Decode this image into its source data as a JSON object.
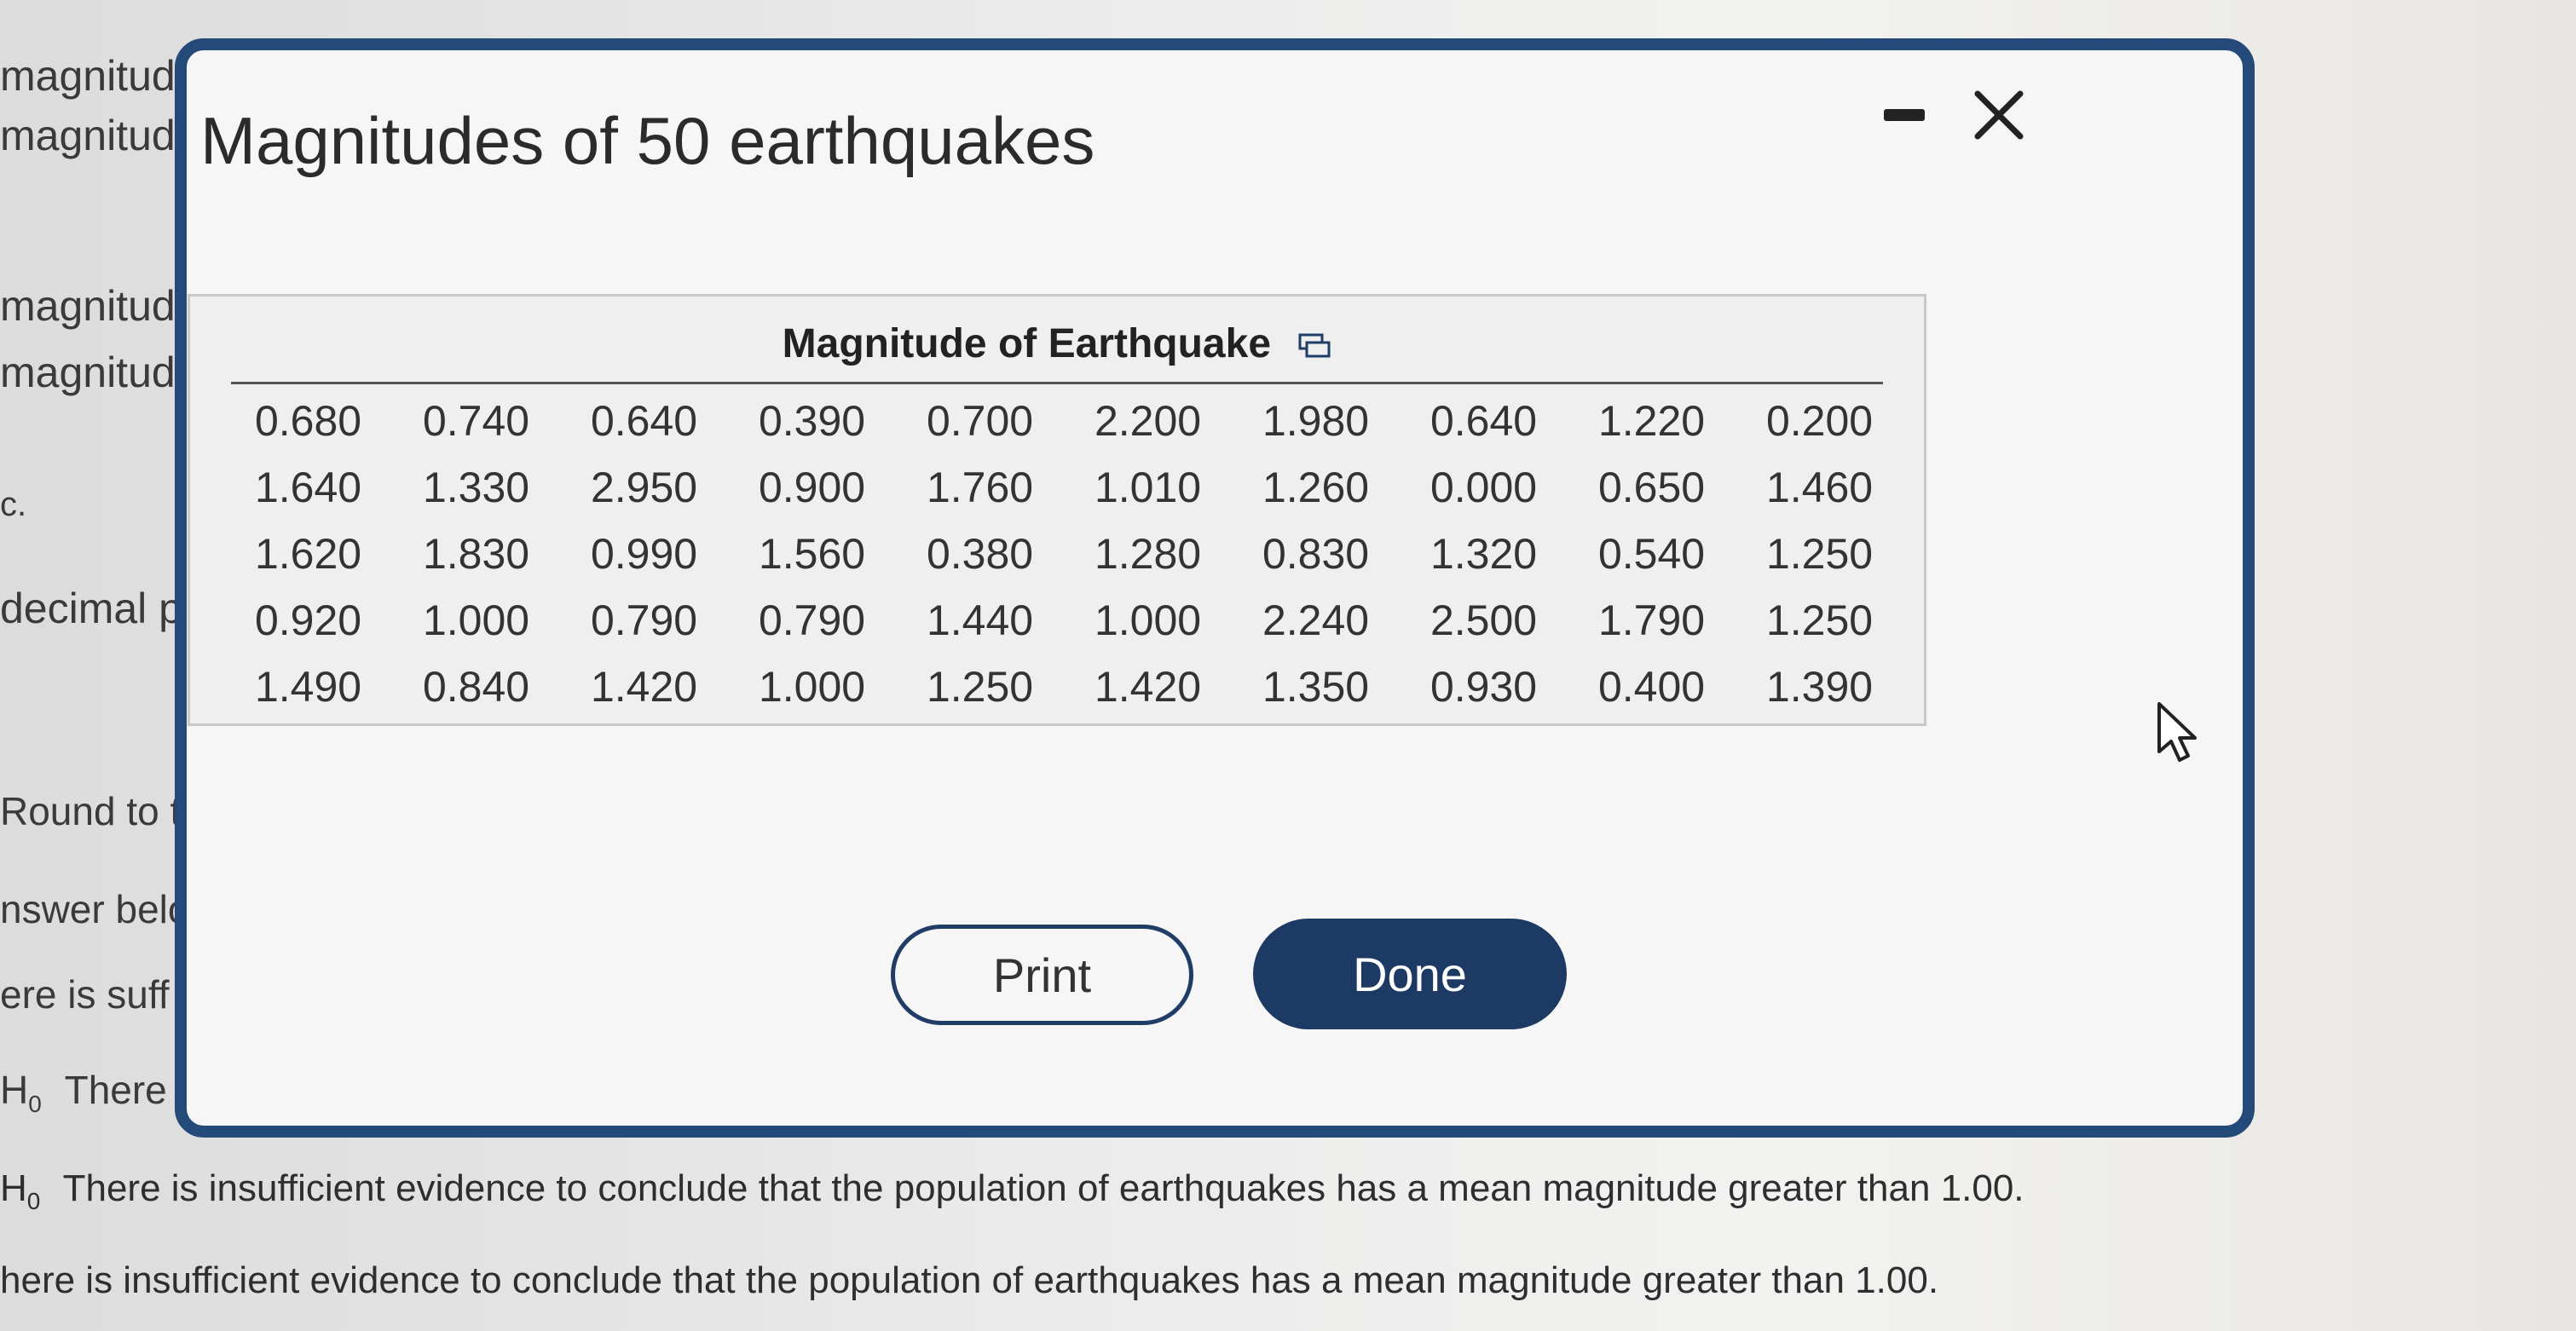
{
  "background": {
    "left_fragments": [
      {
        "text": "magnitud"
      },
      {
        "text": "magnitud"
      },
      {
        "text": "magnitud"
      },
      {
        "text": "magnitud"
      },
      {
        "text": "c."
      },
      {
        "text": "decimal pl"
      },
      {
        "text": "Round to th"
      },
      {
        "text": "nswer belo"
      },
      {
        "text": "ere is suff"
      },
      {
        "text": "There"
      }
    ],
    "h0_symbol": "H",
    "h0_subscript": "0",
    "bottom_line_1": "There is insufficient evidence to conclude that the population of earthquakes has a mean magnitude greater than 1.00.",
    "bottom_line_2": "here is insufficient evidence to conclude that the population of earthquakes has a mean magnitude greater than 1.00."
  },
  "modal": {
    "title": "Magnitudes of 50 earthquakes",
    "minimize_icon": "minimize-icon",
    "close_icon": "close-icon",
    "table": {
      "header": "Magnitude of Earthquake",
      "copy_icon": "copy-icon",
      "rows": [
        [
          "0.680",
          "0.740",
          "0.640",
          "0.390",
          "0.700",
          "2.200",
          "1.980",
          "0.640",
          "1.220",
          "0.200"
        ],
        [
          "1.640",
          "1.330",
          "2.950",
          "0.900",
          "1.760",
          "1.010",
          "1.260",
          "0.000",
          "0.650",
          "1.460"
        ],
        [
          "1.620",
          "1.830",
          "0.990",
          "1.560",
          "0.380",
          "1.280",
          "0.830",
          "1.320",
          "0.540",
          "1.250"
        ],
        [
          "0.920",
          "1.000",
          "0.790",
          "0.790",
          "1.440",
          "1.000",
          "2.240",
          "2.500",
          "1.790",
          "1.250"
        ],
        [
          "1.490",
          "0.840",
          "1.420",
          "1.000",
          "1.250",
          "1.420",
          "1.350",
          "0.930",
          "0.400",
          "1.390"
        ]
      ]
    },
    "buttons": {
      "print_label": "Print",
      "done_label": "Done"
    }
  },
  "colors": {
    "modal_border": "#244a7a",
    "done_button": "#1c3a63",
    "print_border": "#1f3d66"
  }
}
